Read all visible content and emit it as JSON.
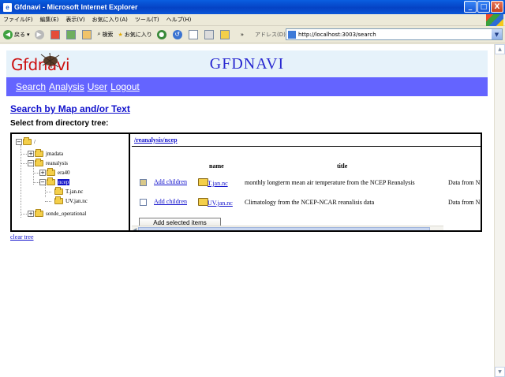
{
  "window": {
    "title": "Gfdnavi - Microsoft Internet Explorer",
    "minimize": "_",
    "maximize": "□",
    "close": "X"
  },
  "menu": [
    "ファイル(F)",
    "編集(E)",
    "表示(V)",
    "お気に入り(A)",
    "ツール(T)",
    "ヘルプ(H)"
  ],
  "toolbar": {
    "back": "戻る",
    "search": "検索",
    "favorites": "お気に入り",
    "address_label": "アドレス(D)",
    "address": "http://localhost:3003/search"
  },
  "header": {
    "logo": "Gfdnavi",
    "title": "GFDNAVI"
  },
  "nav": [
    "Search",
    "Analysis",
    "User",
    "Logout"
  ],
  "section": {
    "heading": "Search by Map and/or Text",
    "subheading": "Select from directory tree:"
  },
  "tree": {
    "root": "/",
    "items": [
      "jmadata",
      "reanalysis",
      "era40",
      "ncep",
      "T.jan.nc",
      "UV.jan.nc",
      "sonde_operational"
    ],
    "clear": "clear tree"
  },
  "listing": {
    "path": "/reanalysis/ncep",
    "columns": {
      "name": "name",
      "title": "title"
    },
    "add_children": "Add children",
    "rows": [
      {
        "name": "T.jan.nc",
        "title": "monthly longterm mean air temperature from the NCEP Reanalysis",
        "extra": "Data from N",
        "checked": true
      },
      {
        "name": "UV.jan.nc",
        "title": "Climatology from the NCEP-NCAR reanalisis data",
        "extra": "Data from N",
        "checked": false
      }
    ],
    "add_selected": "Add selected items"
  }
}
